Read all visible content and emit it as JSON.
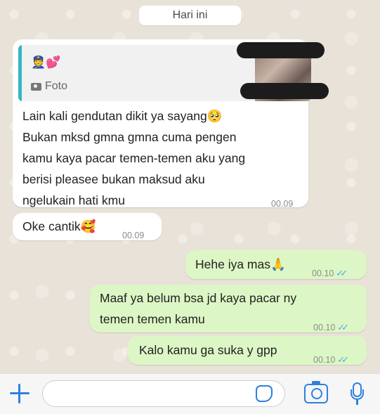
{
  "header": {
    "date_label": "Hari ini"
  },
  "messages": [
    {
      "direction": "in",
      "quote": {
        "emoji": "👮💕",
        "label": "Foto"
      },
      "text_lines": [
        "Lain kali gendutan dikit ya sayang🥺",
        "Bukan mksd gmna gmna cuma pengen",
        "kamu kaya pacar temen-temen aku yang",
        "berisi pleasee bukan maksud aku",
        "ngelukain hati kmu"
      ],
      "time": "00.09"
    },
    {
      "direction": "in",
      "text": "Oke cantik🥰",
      "time": "00.09"
    },
    {
      "direction": "out",
      "text": "Hehe iya mas🙏",
      "time": "00.10",
      "ticks": "✓✓"
    },
    {
      "direction": "out",
      "text_lines": [
        "Maaf ya belum bsa jd kaya pacar ny",
        "temen temen kamu"
      ],
      "time": "00.10",
      "ticks": "✓✓"
    },
    {
      "direction": "out",
      "text": "Kalo kamu ga suka y gpp",
      "time": "00.10",
      "ticks": "✓✓"
    }
  ],
  "composer": {
    "placeholder": ""
  },
  "colors": {
    "accent": "#2f7fe0",
    "incoming": "#ffffff",
    "outgoing": "#dcf7c5",
    "read_ticks": "#4fa9e8",
    "quote_bar": "#35b6c1"
  },
  "icons": [
    "plus-icon",
    "camera-icon",
    "sticker-icon",
    "camera-button-icon",
    "microphone-icon"
  ]
}
